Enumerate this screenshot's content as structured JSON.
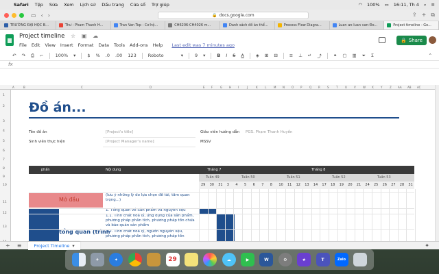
{
  "menubar": {
    "apple_glyph": "",
    "items": [
      "Safari",
      "Tệp",
      "Sửa",
      "Xem",
      "Lịch sử",
      "Dấu trang",
      "Cửa sổ",
      "Trợ giúp"
    ],
    "battery": "100%",
    "clock": "16:11, Th 4"
  },
  "browser": {
    "url": "docs.google.com",
    "tabs": [
      "TRƯỜNG ĐẠI HỌC B...",
      "Thư - Pham Thanh H...",
      "Tran Van Top - Cơ hộ...",
      "CH6206-CH4026 m...",
      "Danh sách đồ án thể...",
      "Process Flow Diagra...",
      "Luan an-luan van-Đo...",
      "Project timeline - Go..."
    ]
  },
  "doc": {
    "title": "Project timeline",
    "menu": [
      "File",
      "Edit",
      "View",
      "Insert",
      "Format",
      "Data",
      "Tools",
      "Add-ons",
      "Help"
    ],
    "last_edit": "Last edit was 7 minutes ago",
    "share_label": "Share",
    "accent": "#1a8a4a"
  },
  "toolbar": {
    "zoom": "100%",
    "currency": "$",
    "percent": "%",
    "decimal_dec": ".0",
    "decimal_inc": ".00",
    "number_format": "123",
    "font": "Roboto",
    "font_size": "9",
    "bold": "B",
    "italic": "I",
    "strike": "S",
    "text_color": "A"
  },
  "formula": {
    "fx": "fx"
  },
  "sheet": {
    "columns": [
      "A",
      "B",
      "C",
      "D",
      "E",
      "F",
      "G",
      "H",
      "I",
      "J",
      "K",
      "L",
      "M",
      "N",
      "O",
      "P",
      "Q",
      "R",
      "S",
      "T",
      "U",
      "V",
      "W",
      "X",
      "Y",
      "Z",
      "AA",
      "AB",
      "AC"
    ],
    "rows": [
      "1",
      "2",
      "3",
      "4",
      "5",
      "6",
      "7",
      "8",
      "9",
      "10",
      "11",
      "12",
      "13",
      "14"
    ],
    "title": "Đồ án...",
    "fields": {
      "ten_do_an": "Tên đồ án",
      "project_title_ph": "[Project's title]",
      "gvhd": "Giáo viên hướng dẫn",
      "gvhd_value": "PGS. Phạm Thanh Huyền",
      "sinh_vien": "Sinh viên thực hiện",
      "manager_ph": "[Project Manager's name]",
      "mssv": "MSSV"
    },
    "header": {
      "phan": "phần",
      "noi_dung": "Nội dung",
      "month7": "Tháng 7",
      "month8": "Tháng 8"
    },
    "weeks": [
      "Tuần 49",
      "Tuần 50",
      "Tuần 51",
      "Tuần 52",
      "Tuần 53"
    ],
    "days": [
      "29",
      "30",
      "31",
      "3",
      "4",
      "5",
      "6",
      "7",
      "8",
      "10",
      "11",
      "12",
      "13",
      "14",
      "17",
      "18",
      "19",
      "20",
      "21",
      "24",
      "25",
      "26",
      "27",
      "28",
      "31"
    ],
    "sections": {
      "mo_dau": "Mở đầu",
      "tong_quan": "tổng quan (trình"
    },
    "content": {
      "r11": "(lưu ý những lý do lựa chọn đề tài, tầm quan trọng...)",
      "r12": "1. Tổng quan về Sản phẩm và nguyên liệu",
      "r13": "1.1. Tính chất hoá lý, ứng dụng của sản phẩm, phương pháp phân tích, phương pháp tồn chứa và bảo quản sản phẩm",
      "r14": "1.2. Tính chất hoá lý, nguồn nguyên liệu, phương pháp phân tích, phương pháp tồn"
    },
    "sheet_tab": "Project Timeline"
  },
  "dock": {
    "apps": [
      "Finder",
      "Launchpad",
      "Safari",
      "Chrome",
      "Notes",
      "Calendar",
      "Stickies",
      "Photos",
      "Messages",
      "FaceTime",
      "Word",
      "System Preferences",
      "iMovie",
      "Teams",
      "Zalo",
      "Trash"
    ],
    "calendar_day": "29",
    "word_letter": "W",
    "zalo_label": "Zalo"
  }
}
